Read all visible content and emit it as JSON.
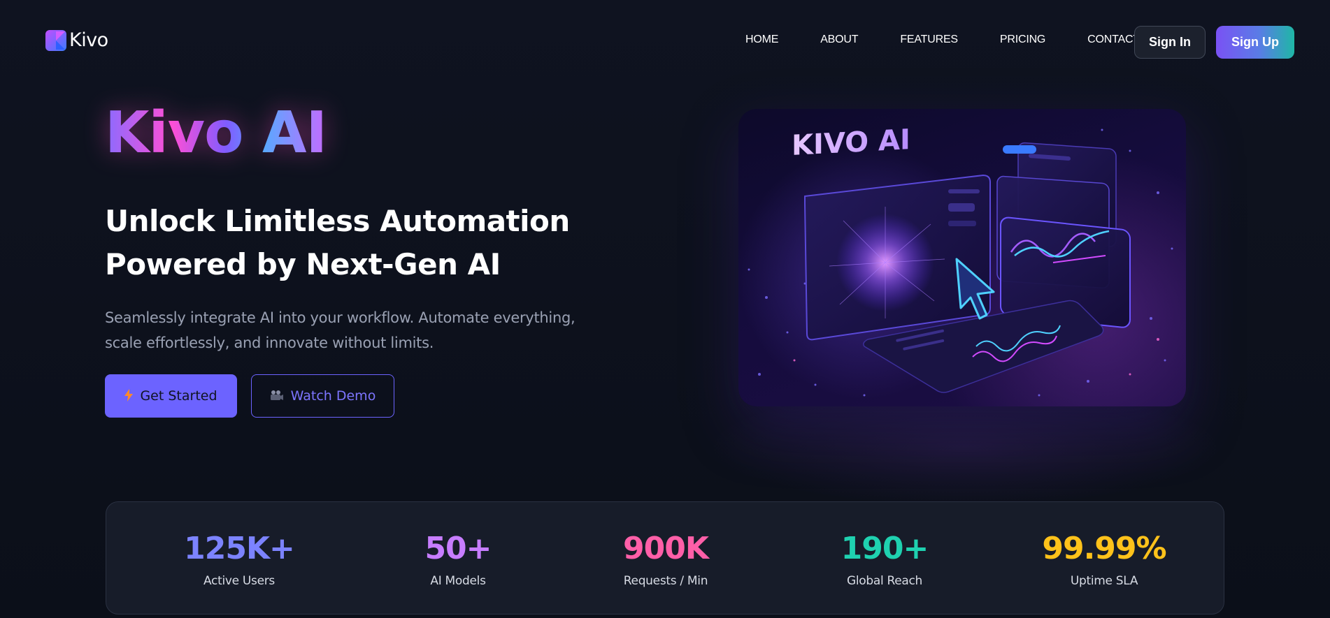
{
  "header": {
    "brand": "Kivo",
    "nav": [
      "HOME",
      "ABOUT",
      "FEATURES",
      "PRICING",
      "CONTACT"
    ],
    "sign_in_label": "Sign In",
    "sign_up_label": "Sign Up"
  },
  "hero": {
    "title": "Kivo AI",
    "heading_line1": "Unlock Limitless Automation",
    "heading_line2": "Powered by Next-Gen AI",
    "subtitle": "Seamlessly integrate AI into your workflow. Automate everything, scale effortlessly, and innovate without limits.",
    "primary_cta": {
      "label": "Get Started",
      "icon": "lightning-icon"
    },
    "secondary_cta": {
      "label": "Watch Demo",
      "icon": "video-camera-icon"
    },
    "illustration_text": "KIVO AI"
  },
  "stats": [
    {
      "value": "125K+",
      "label": "Active Users",
      "color": "#7c83ff"
    },
    {
      "value": "50+",
      "label": "AI Models",
      "color": "#c77dff"
    },
    {
      "value": "900K",
      "label": "Requests / Min",
      "color": "#ff5fa8"
    },
    {
      "value": "190+",
      "label": "Global Reach",
      "color": "#1fd1b0"
    },
    {
      "value": "99.99%",
      "label": "Uptime SLA",
      "color": "#ffc21a"
    }
  ],
  "colors": {
    "background": "#0d111c",
    "accent": "#6c63ff",
    "card": "#171c29"
  }
}
